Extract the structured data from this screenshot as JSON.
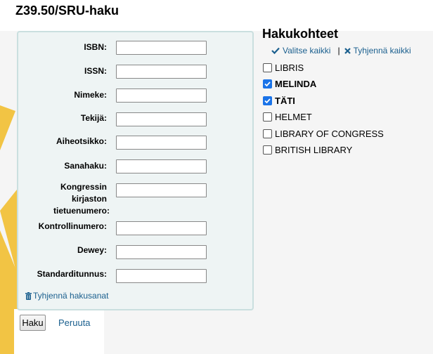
{
  "page": {
    "title": "Z39.50/SRU-haku"
  },
  "form": {
    "fields": [
      {
        "label": "ISBN:",
        "value": ""
      },
      {
        "label": "ISSN:",
        "value": ""
      },
      {
        "label": "Nimeke:",
        "value": ""
      },
      {
        "label": "Tekijä:",
        "value": ""
      },
      {
        "label": "Aiheotsikko:",
        "value": ""
      },
      {
        "label": "Sanahaku:",
        "value": ""
      },
      {
        "label": "Kongressin kirjaston tietuenumero:",
        "value": ""
      },
      {
        "label": "Kontrollinumero:",
        "value": ""
      },
      {
        "label": "Dewey:",
        "value": ""
      },
      {
        "label": "Standarditunnus:",
        "value": ""
      }
    ],
    "clear_terms_label": "Tyhjennä hakusanat"
  },
  "actions": {
    "search_label": "Haku",
    "cancel_label": "Peruuta"
  },
  "targets": {
    "title": "Hakukohteet",
    "select_all_label": "Valitse kaikki",
    "clear_all_label": "Tyhjennä kaikki",
    "items": [
      {
        "label": "LIBRIS",
        "checked": false
      },
      {
        "label": "MELINDA",
        "checked": true
      },
      {
        "label": "TÄTI",
        "checked": true
      },
      {
        "label": "HELMET",
        "checked": false
      },
      {
        "label": "LIBRARY OF CONGRESS",
        "checked": false
      },
      {
        "label": "BRITISH LIBRARY",
        "checked": false
      }
    ]
  },
  "colors": {
    "link": "#1a5f8e",
    "checkbox_checked": "#1a73e8",
    "decor_yellow": "#f2c444",
    "panel_bg": "#eef4f4",
    "panel_border": "#cadfdf"
  },
  "icons": {
    "select_all": "check-icon",
    "clear_all": "x-icon",
    "clear_terms": "trash-icon"
  }
}
